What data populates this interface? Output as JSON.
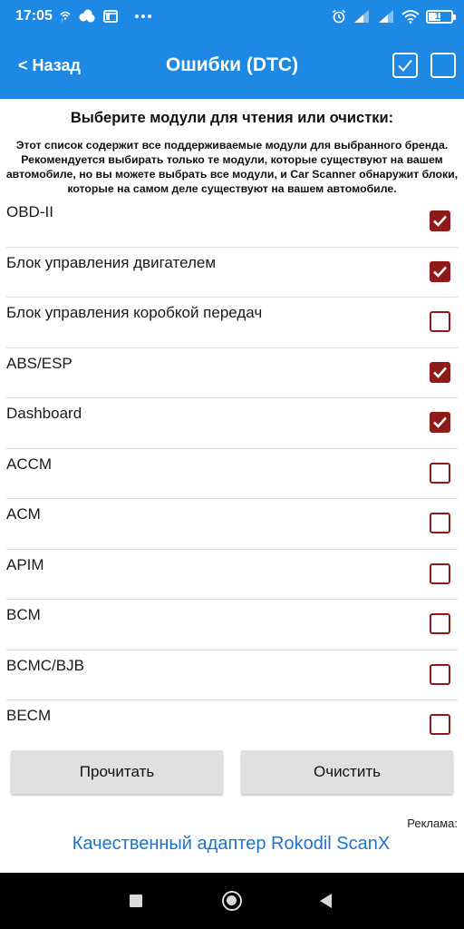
{
  "status_bar": {
    "time": "17:05",
    "battery_percent": "11",
    "icons": [
      "wifi-calling-icon",
      "cloud-icon",
      "cast-icon",
      "more-dots-icon",
      "alarm-icon",
      "signal-icon",
      "signal-icon",
      "wifi-icon",
      "battery-icon"
    ]
  },
  "header": {
    "back_label": "< Назад",
    "title": "Ошибки (DTC)"
  },
  "content": {
    "heading": "Выберите модули для чтения или очистки:",
    "description": "Этот список содержит все поддерживаемые модули для выбранного бренда. Рекомендуется выбирать только те модули, которые существуют на вашем автомобиле, но вы можете выбрать все модули, и Car Scanner обнаружит блоки, которые на самом деле существуют на вашем автомобиле."
  },
  "modules": [
    {
      "label": "OBD-II",
      "checked": true
    },
    {
      "label": "Блок управления двигателем",
      "checked": true
    },
    {
      "label": "Блок управления коробкой передач",
      "checked": false
    },
    {
      "label": "ABS/ESP",
      "checked": true
    },
    {
      "label": "Dashboard",
      "checked": true
    },
    {
      "label": "ACCM",
      "checked": false
    },
    {
      "label": "ACM",
      "checked": false
    },
    {
      "label": "APIM",
      "checked": false
    },
    {
      "label": "BCM",
      "checked": false
    },
    {
      "label": "BCMC/BJB",
      "checked": false
    },
    {
      "label": "BECM",
      "checked": false
    }
  ],
  "buttons": {
    "read": "Прочитать",
    "clear": "Очистить"
  },
  "ad": {
    "label": "Реклама:",
    "link_text": "Качественный адаптер Rokodil ScanX"
  },
  "colors": {
    "header_bg": "#1e88e5",
    "checkbox": "#8e1a1a",
    "ad_link": "#1e73c8"
  }
}
